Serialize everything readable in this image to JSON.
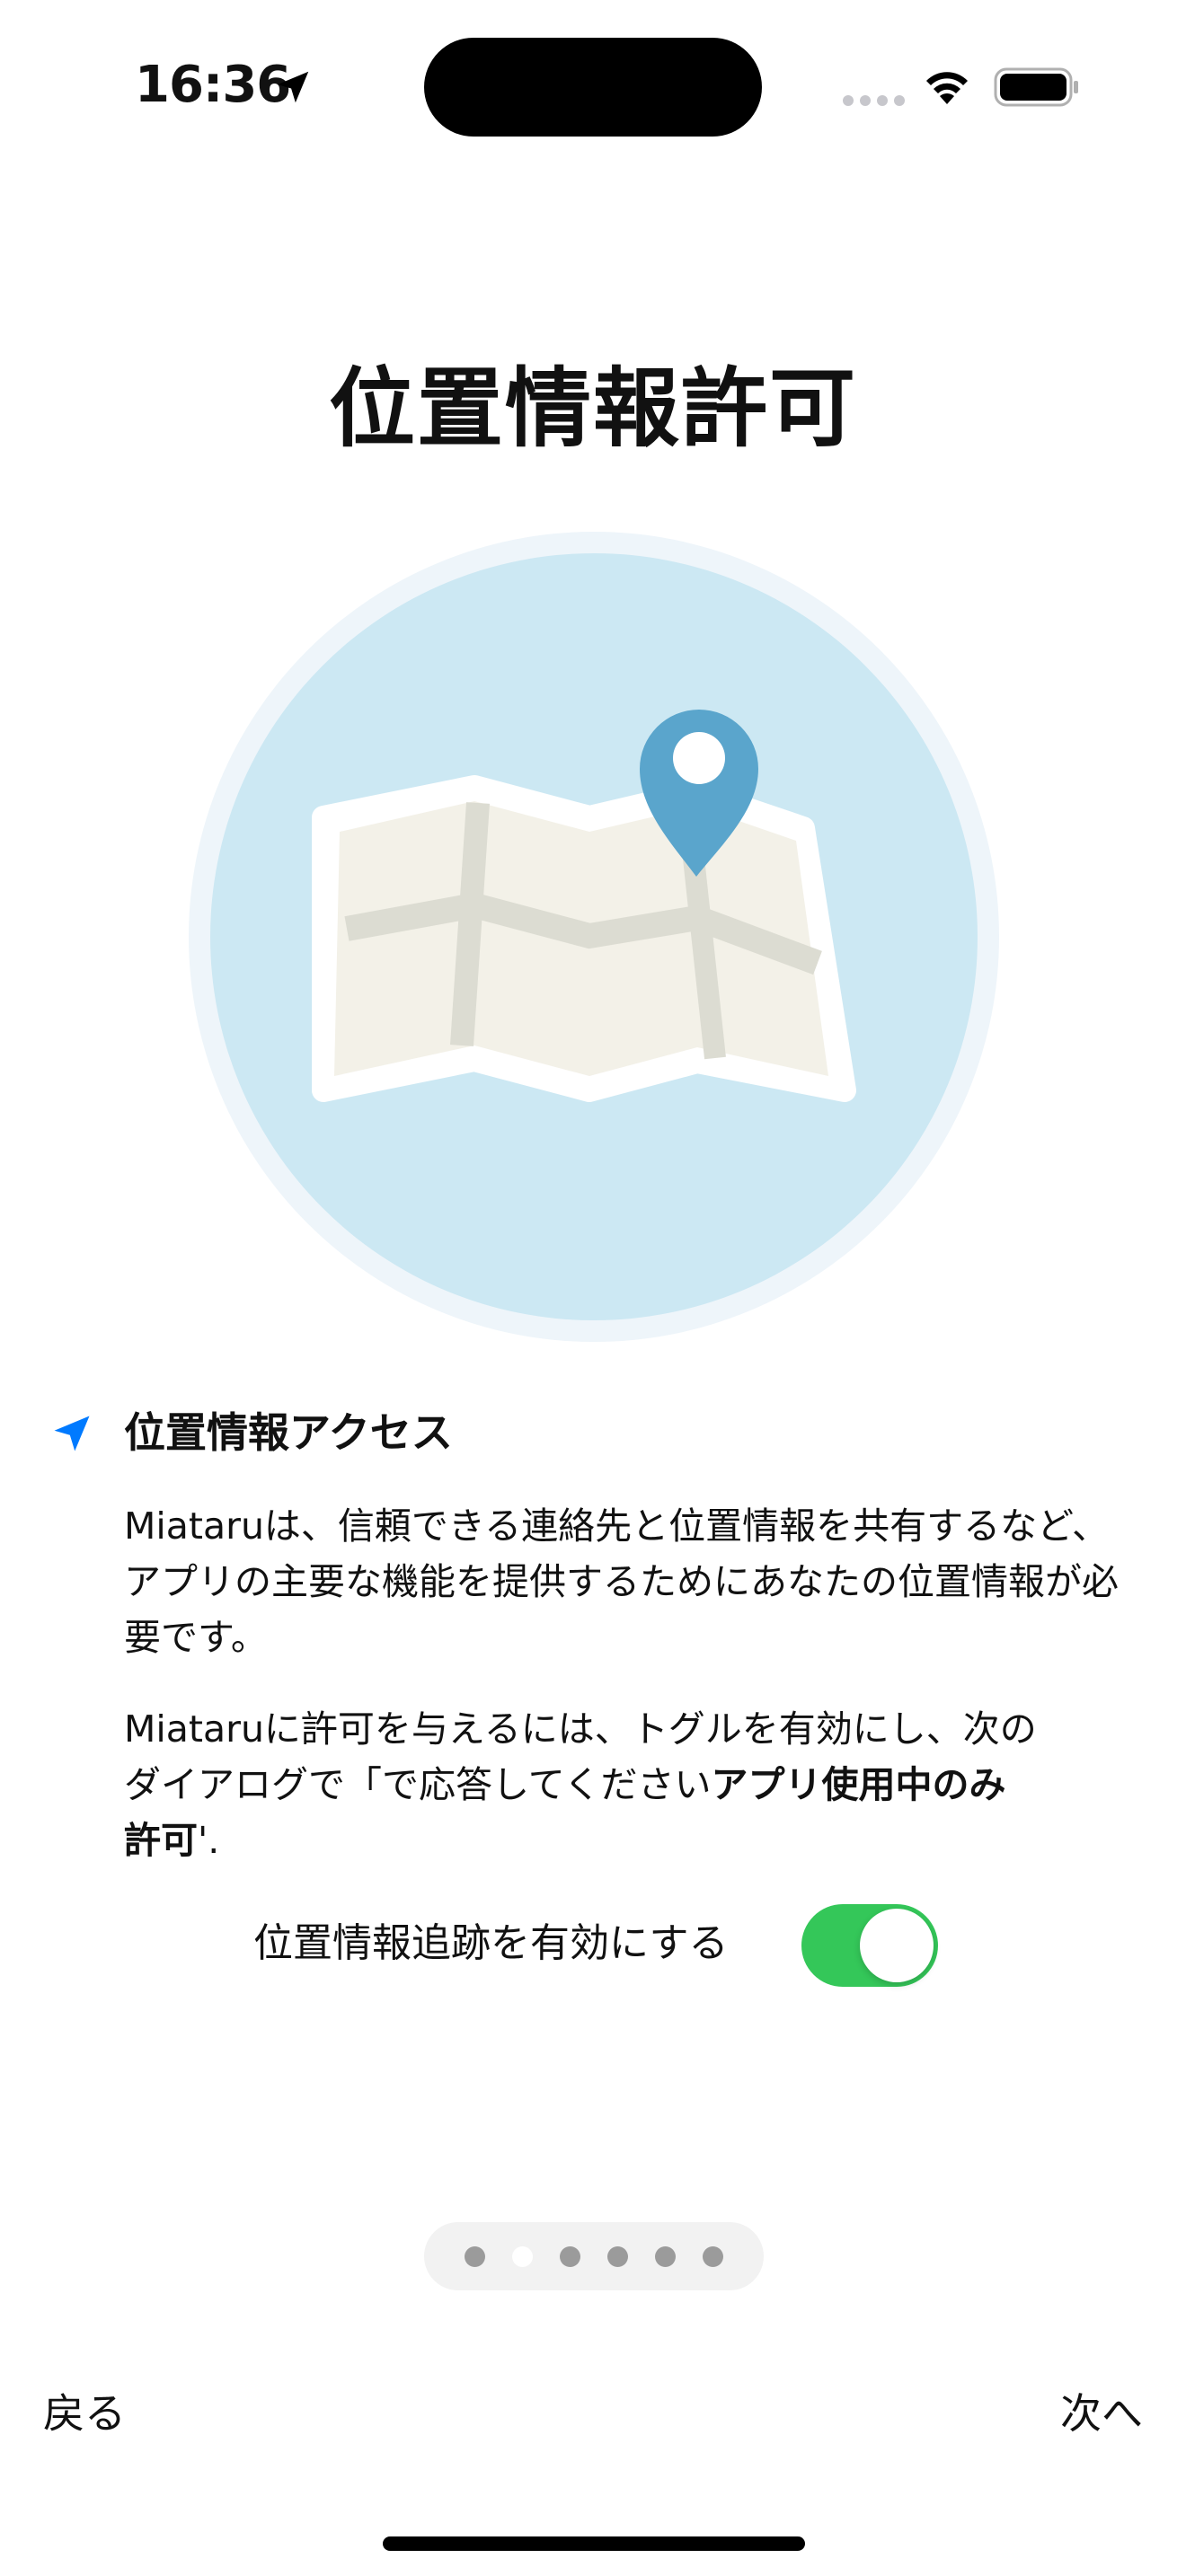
{
  "status_bar": {
    "time": "16:36"
  },
  "page": {
    "title": "位置情報許可"
  },
  "section": {
    "title": "位置情報アクセス",
    "paragraph_1": "Miataruは、信頼できる連絡先と位置情報を共有するなど、アプリの主要な機能を提供するためにあなたの位置情報が必要です。",
    "paragraph_2_prefix": "Miataruに許可を与えるには、トグルを有効にし、次のダイアログで「で応答してください",
    "paragraph_2_bold": "アプリ使用中のみ許可",
    "paragraph_2_suffix": "'."
  },
  "toggle": {
    "label": "位置情報追跡を有効にする",
    "enabled": true
  },
  "pager": {
    "total": 6,
    "current": 2
  },
  "navigation": {
    "back_label": "戻る",
    "next_label": "次へ"
  },
  "colors": {
    "accent": "#007aff",
    "toggle_on": "#34c759",
    "pin": "#5aa5cc",
    "circle_bg": "#cce8f3"
  },
  "icons": {
    "status_location": "location-arrow-icon",
    "section": "location-arrow-icon",
    "wifi": "wifi-icon",
    "battery": "battery-icon"
  }
}
